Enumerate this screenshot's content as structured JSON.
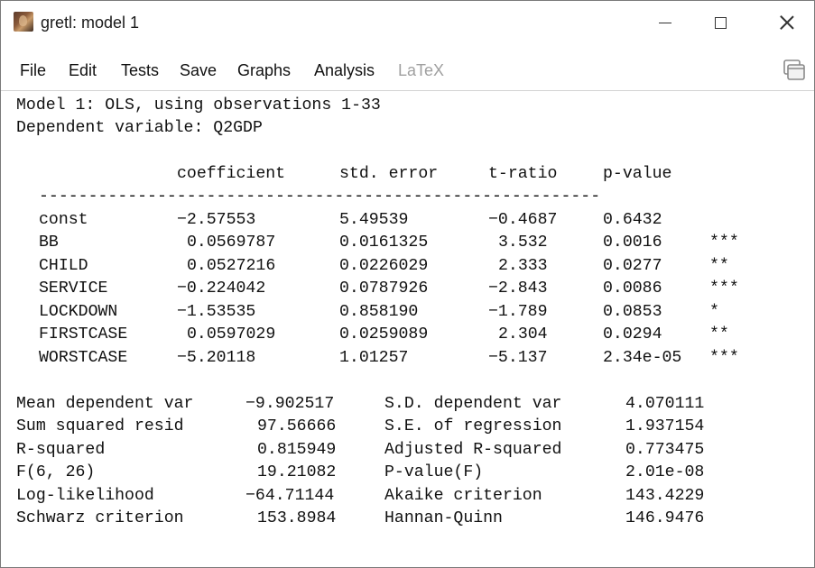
{
  "window": {
    "title": "gretl: model 1"
  },
  "menu": [
    {
      "label": "File"
    },
    {
      "label": "Edit"
    },
    {
      "label": "Tests"
    },
    {
      "label": "Save"
    },
    {
      "label": "Graphs"
    },
    {
      "label": "Analysis"
    },
    {
      "label": "LaTeX",
      "disabled": true
    }
  ],
  "output": {
    "header_line1": "Model 1: OLS, using observations 1-33",
    "header_line2": "Dependent variable: Q2GDP",
    "col_headers": [
      "coefficient",
      "std. error",
      "t-ratio",
      "p-value"
    ],
    "separator": "---------------------------------------------------------",
    "rows": [
      {
        "name": "const",
        "coef": "−2.57553",
        "se": "5.49539",
        "t": "−0.4687",
        "p": "0.6432",
        "stars": ""
      },
      {
        "name": "BB",
        "coef": "0.0569787",
        "se": "0.0161325",
        "t": "3.532",
        "p": "0.0016",
        "stars": "***"
      },
      {
        "name": "CHILD",
        "coef": "0.0527216",
        "se": "0.0226029",
        "t": "2.333",
        "p": "0.0277",
        "stars": "**"
      },
      {
        "name": "SERVICE",
        "coef": "−0.224042",
        "se": "0.0787926",
        "t": "−2.843",
        "p": "0.0086",
        "stars": "***"
      },
      {
        "name": "LOCKDOWN",
        "coef": "−1.53535",
        "se": "0.858190",
        "t": "−1.789",
        "p": "0.0853",
        "stars": "*"
      },
      {
        "name": "FIRSTCASE",
        "coef": "0.0597029",
        "se": "0.0259089",
        "t": "2.304",
        "p": "0.0294",
        "stars": "**"
      },
      {
        "name": "WORSTCASE",
        "coef": "−5.20118",
        "se": "1.01257",
        "t": "−5.137",
        "p": "2.34e-05",
        "stars": "***"
      }
    ],
    "stats": [
      {
        "l1": "Mean dependent var",
        "v1": "−9.902517",
        "l2": "S.D. dependent var",
        "v2": "4.070111"
      },
      {
        "l1": "Sum squared resid",
        "v1": "97.56666",
        "l2": "S.E. of regression",
        "v2": "1.937154"
      },
      {
        "l1": "R-squared",
        "v1": "0.815949",
        "l2": "Adjusted R-squared",
        "v2": "0.773475"
      },
      {
        "l1": "F(6, 26)",
        "v1": "19.21082",
        "l2": "P-value(F)",
        "v2": "2.01e-08"
      },
      {
        "l1": "Log-likelihood",
        "v1": "−64.71144",
        "l2": "Akaike criterion",
        "v2": "143.4229"
      },
      {
        "l1": "Schwarz criterion",
        "v1": "153.8984",
        "l2": "Hannan-Quinn",
        "v2": "146.9476"
      }
    ]
  }
}
